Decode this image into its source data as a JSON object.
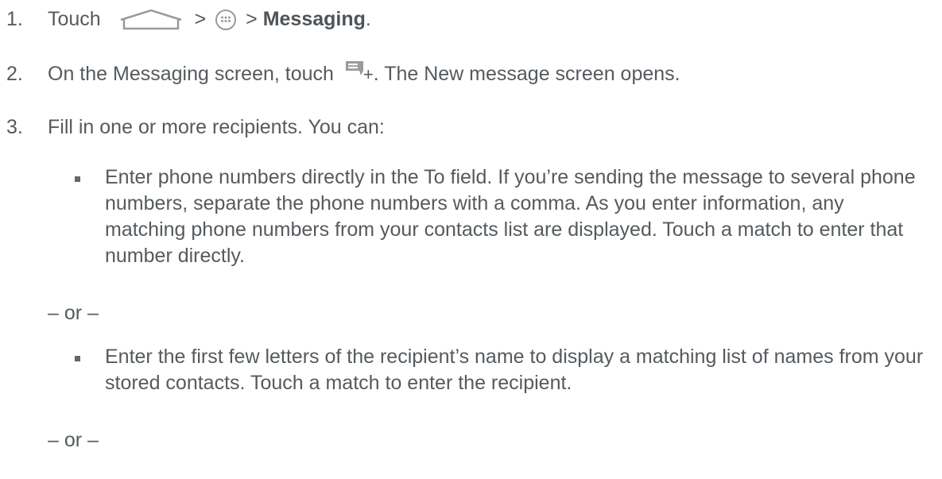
{
  "steps": [
    {
      "number": "1.",
      "pre": "Touch",
      "sep1": ">",
      "sep2": ">",
      "bold": "Messaging",
      "post": "."
    },
    {
      "number": "2.",
      "pre": "On the Messaging screen, touch",
      "plus": "+",
      "post": ". The New message screen opens."
    },
    {
      "number": "3.",
      "text": "Fill in one or more recipients. You can:"
    }
  ],
  "bullets": [
    "Enter phone numbers directly in the To field. If you’re sending the message to several phone numbers, separate the phone numbers with a comma. As you enter information, any matching phone numbers from your contacts list are displayed. Touch a match to enter that number directly.",
    "Enter the first few letters of the recipient’s name to display a matching list of names from your stored contacts. Touch a match to enter the recipient."
  ],
  "separator": "– or –",
  "icons": [
    "home-icon",
    "apps-icon",
    "new-message-icon"
  ]
}
